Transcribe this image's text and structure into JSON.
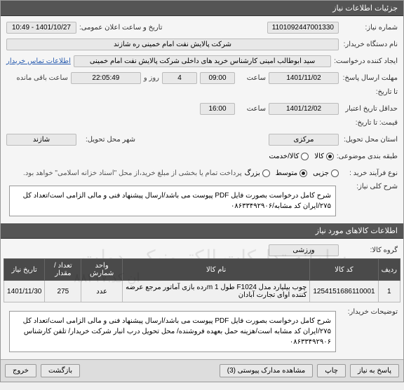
{
  "header": {
    "title": "جزئیات اطلاعات نیاز"
  },
  "fields": {
    "need_number_label": "شماره نیاز:",
    "need_number": "1101092447001330",
    "announce_label": "تاریخ و ساعت اعلان عمومی:",
    "announce_value": "1401/10/27 - 10:49",
    "org_label": "نام دستگاه خریدار:",
    "org_value": "شرکت پالایش نفت امام خمینی  ره  شازند",
    "creator_label": "ایجاد کننده درخواست:",
    "creator_value": "سید ابوطالب  امینی کارشناس خرید های داخلی  شرکت پالایش نفت امام خمینی",
    "contact_link": "اطلاعات تماس خریدار",
    "deadline_send_label": "مهلت ارسال پاسخ:",
    "to_date_label": "تا تاریخ:",
    "deadline_date": "1401/11/02",
    "at_label": "ساعت",
    "deadline_time": "09:00",
    "days_count": "4",
    "and_label": "روز و",
    "remain_time": "22:05:49",
    "remain_label": "ساعت باقی مانده",
    "valid_label": "حداقل تاریخ اعتبار",
    "price_to_label": "قیمت: تا تاریخ:",
    "valid_date": "1401/12/02",
    "valid_time": "16:00",
    "state_label": "استان محل تحویل:",
    "state_value": "مرکزی",
    "city_label": "شهر محل تحویل:",
    "city_value": "شازند",
    "sep_label": "طبقه بندی موضوعی:",
    "sep_goods": "کالا",
    "sep_service": "کالا/خدمت",
    "proc_label": "نوع فرآیند خرید :",
    "proc_small": "جزیی",
    "proc_mid": "متوسط",
    "proc_big": "بزرگ",
    "pay_note": "پرداخت تمام یا بخشی از مبلغ خرید،از محل \"اسناد خزانه اسلامی\" خواهد بود.",
    "desc_label": "شرح کلی نیاز:",
    "desc_text": "شرح کامل درخواست بصورت فایل PDF پیوست می باشد/ارسال پیشنهاد فنی و مالی الزامی است/تعداد کل ۲۷۵/ایران کد مشابه/۰۸۶۳۳۴۹۲۹۰۶"
  },
  "goods_section": {
    "title": "اطلاعات کالاهای مورد نیاز",
    "group_label": "گروه کالا:",
    "group_value": "ورزشی",
    "watermark": "سامانه تدارکات الکترونیکی دولت",
    "watermark2": "ان کد:۸۸۲۱۷"
  },
  "table": {
    "headers": [
      "ردیف",
      "کد کالا",
      "نام کالا",
      "واحد شمارش",
      "تعداد / مقدار",
      "تاریخ نیاز"
    ],
    "row": {
      "idx": "1",
      "code": "1254151686110001",
      "name": "چوب بیلیارد مدل F1024 طول 1 mرده بازی آماتور مرجع عرضه کننده اوای تجارت آبادان",
      "unit": "عدد",
      "qty": "275",
      "date": "1401/11/30"
    }
  },
  "buyer_notes": {
    "label": "توضیحات خریدار:",
    "text": "شرح کامل درخواست بصورت فایل PDF پیوست می باشد/ارسال پیشنهاد فنی و مالی الزامی است/تعداد کل ۲۷۵/ایران کد مشابه است/هزینه حمل بعهده فروشنده/ محل تحویل درب انبار شرکت خریدار/ تلفن کارشناس ۰۸۶۳۳۴۹۲۹۰۶"
  },
  "bottom": {
    "reply": "پاسخ به نیاز",
    "print": "چاپ",
    "attach": "مشاهده مدارک پیوستی",
    "attach_count": "3",
    "back": "بازگشت",
    "exit": "خروج"
  }
}
